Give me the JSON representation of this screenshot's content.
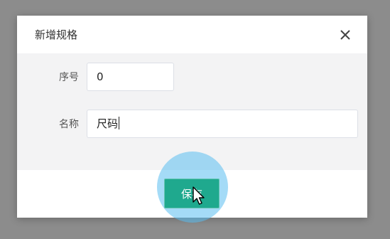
{
  "dialog": {
    "title": "新增规格",
    "close_icon": "close-icon"
  },
  "form": {
    "fields": [
      {
        "label": "序号",
        "value": "0"
      },
      {
        "label": "名称",
        "value": "尺码"
      }
    ]
  },
  "footer": {
    "save_label": "保存"
  },
  "colors": {
    "primary": "#1fa98e",
    "body_bg": "#f3f3f4",
    "overlay": "#8c8c8c",
    "click_highlight": "#5abef0"
  }
}
